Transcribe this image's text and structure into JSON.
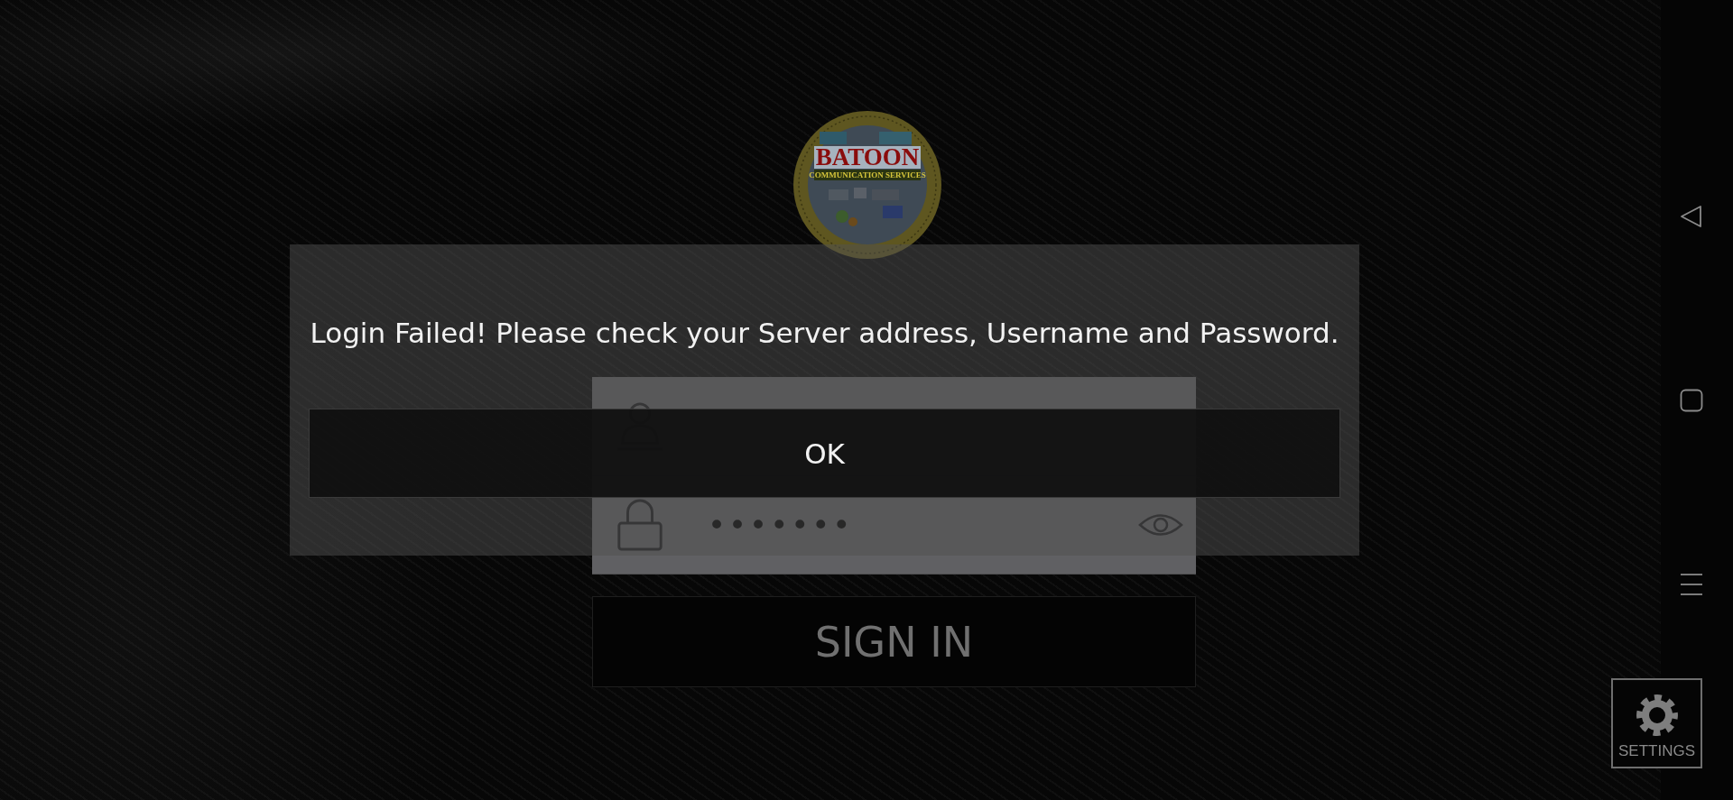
{
  "logo": {
    "title": "BATOON",
    "subtitle": "COMMUNICATION SERVICES"
  },
  "login_form": {
    "fields": [
      {
        "kind": "username"
      },
      {
        "kind": "password",
        "value": "•••••••"
      }
    ]
  },
  "sign_in_button": {
    "label": "SIGN IN"
  },
  "nav_bar": {
    "buttons": [
      {
        "kind": "back"
      },
      {
        "kind": "home"
      },
      {
        "kind": "menu"
      }
    ]
  },
  "settings_button": {
    "label": "SETTINGS"
  },
  "dialog": {
    "message": "Login Failed! Please check your Server address, Username and Password.",
    "buttons": [
      "OK"
    ]
  }
}
